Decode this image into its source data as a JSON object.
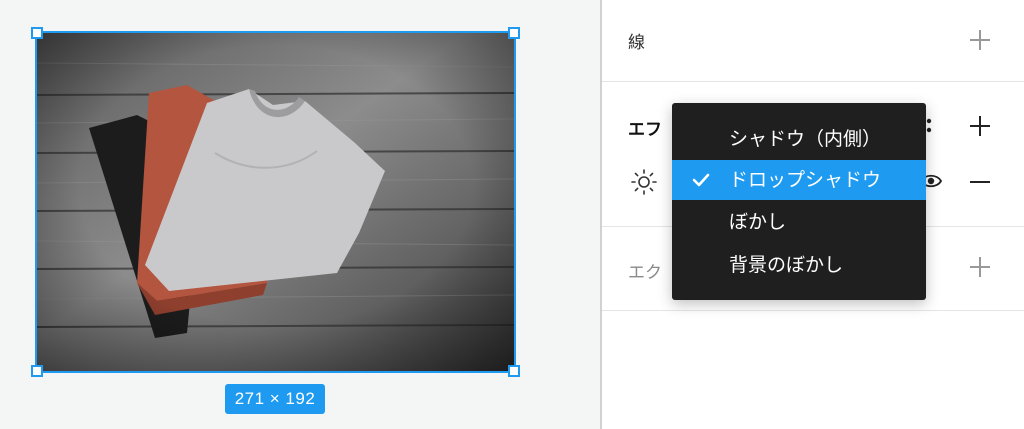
{
  "canvas": {
    "dimension_label": "271 × 192",
    "selection_color": "#1e9bf0"
  },
  "panel": {
    "stroke_section": {
      "label": "線"
    },
    "effects_section": {
      "label_visible": "エフ"
    },
    "export_section": {
      "label_visible": "エク"
    }
  },
  "effect_menu": {
    "items": [
      {
        "label": "シャドウ（内側）",
        "selected": false
      },
      {
        "label": "ドロップシャドウ",
        "selected": true
      },
      {
        "label": "ぼかし",
        "selected": false
      },
      {
        "label": "背景のぼかし",
        "selected": false
      }
    ]
  },
  "icons": [
    "plus-icon",
    "minus-icon",
    "sun-icon",
    "eye-icon",
    "check-icon",
    "more-dots-icon"
  ]
}
